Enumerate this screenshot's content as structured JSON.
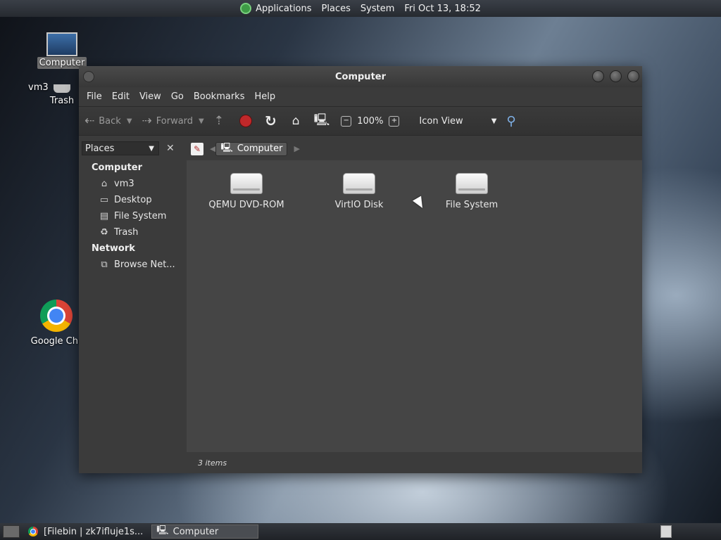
{
  "top_panel": {
    "applications": "Applications",
    "places": "Places",
    "system": "System",
    "clock": "Fri Oct 13, 18:52"
  },
  "desktop": {
    "computer_label": "Computer",
    "home_label": "vm3",
    "trash_label": "Trash",
    "chrome_label": "Google Chr"
  },
  "window": {
    "title": "Computer",
    "menu": [
      "File",
      "Edit",
      "View",
      "Go",
      "Bookmarks",
      "Help"
    ],
    "toolbar": {
      "back": "Back",
      "forward": "Forward",
      "zoom": "100%",
      "view_mode": "Icon View"
    },
    "sidebar": {
      "selector": "Places",
      "sections": [
        {
          "title": "Computer",
          "items": [
            "vm3",
            "Desktop",
            "File System",
            "Trash"
          ]
        },
        {
          "title": "Network",
          "items": [
            "Browse Net..."
          ]
        }
      ]
    },
    "location": {
      "crumb": "Computer"
    },
    "files": [
      "QEMU DVD-ROM",
      "VirtIO Disk",
      "File System"
    ],
    "status": "3 items"
  },
  "taskbar": {
    "items": [
      "[Filebin | zk7ifluje1s...",
      "Computer"
    ]
  },
  "icons": {
    "back": "back-arrow-icon",
    "forward": "forward-arrow-icon",
    "up": "up-arrow-icon",
    "stop": "stop-icon",
    "reload": "reload-icon",
    "home": "home-folder-icon",
    "computer": "computer-icon",
    "search": "search-icon"
  },
  "colors": {
    "stop": "#c0282a",
    "window_bg": "#3b3b3b",
    "content_bg": "#454545"
  }
}
